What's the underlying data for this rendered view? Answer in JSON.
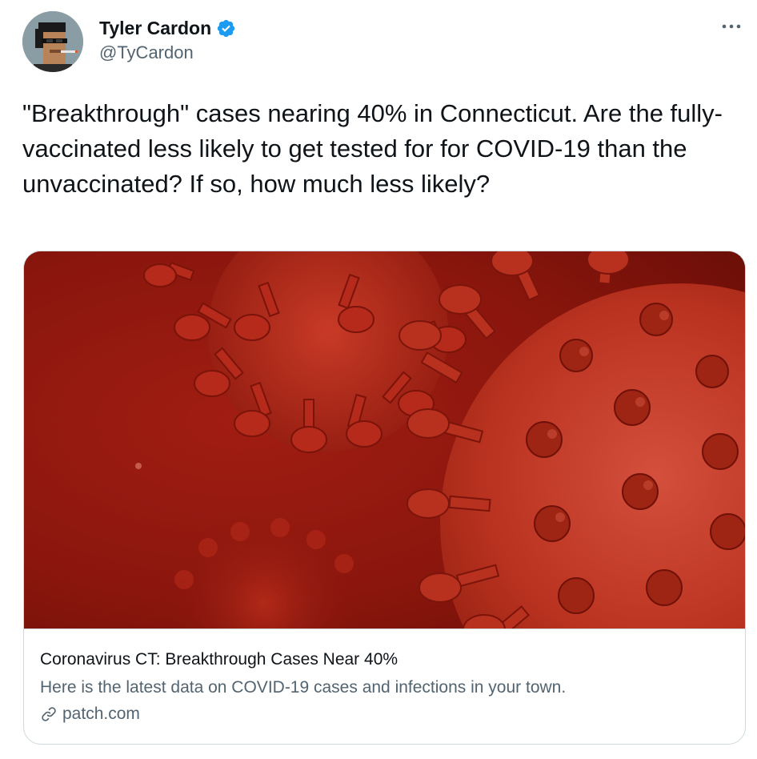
{
  "author": {
    "display_name": "Tyler Cardon",
    "handle": "@TyCardon",
    "verified": true
  },
  "tweet": {
    "text": "\"Breakthrough\" cases nearing 40% in Connecticut. Are the fully-vaccinated less likely to get tested for for COVID-19 than the unvaccinated? If so, how much less likely?"
  },
  "card": {
    "title": "Coronavirus CT: Breakthrough Cases Near 40%",
    "description": "Here is the latest data on COVID-19 cases and infections in your town.",
    "domain": "patch.com"
  },
  "icons": {
    "more": "more-horizontal-icon",
    "verified": "verified-badge-icon",
    "link": "link-icon"
  },
  "colors": {
    "verified_blue": "#1d9bf0",
    "secondary_text": "#536471",
    "border": "#cfd9de",
    "virus_red": "#b3261a"
  }
}
